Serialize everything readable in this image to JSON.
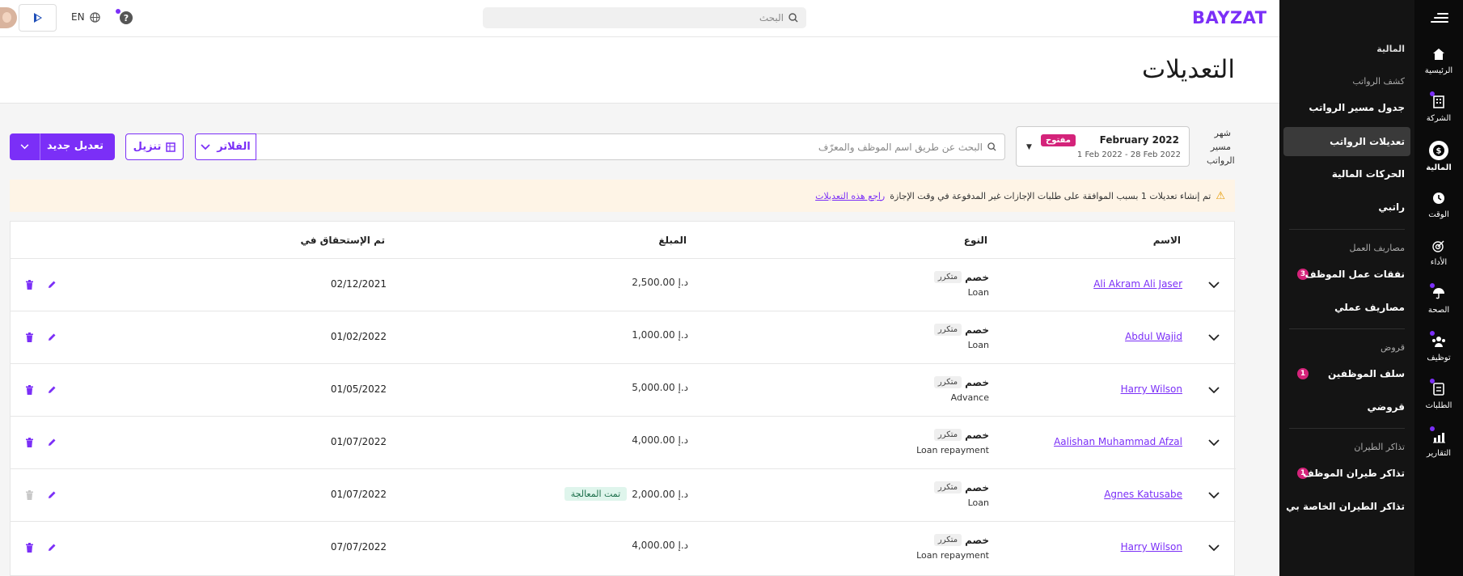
{
  "app": {
    "brand": "BAYZAT"
  },
  "topbar": {
    "lang": "EN",
    "search_placeholder": "البحث",
    "help": "?"
  },
  "page": {
    "title": "التعديلات"
  },
  "sidebar": {
    "rail": [
      {
        "label": "الرئيسية",
        "icon": "home-icon"
      },
      {
        "label": "الشركة",
        "icon": "building-icon"
      },
      {
        "label": "المالية",
        "icon": "dollar-icon"
      },
      {
        "label": "الوقت",
        "icon": "clock-icon"
      },
      {
        "label": "الأداء",
        "icon": "target-icon"
      },
      {
        "label": "الصحة",
        "icon": "umbrella-icon"
      },
      {
        "label": "توظيف",
        "icon": "people-icon"
      },
      {
        "label": "الطلبات",
        "icon": "request-icon"
      },
      {
        "label": "التقارير",
        "icon": "chart-icon"
      }
    ],
    "header": "المالية",
    "sections": {
      "payroll": "كشف الرواتب",
      "expenses": "مصاريف العمل",
      "loans": "قروض",
      "tickets": "تذاكر الطيران"
    },
    "items": {
      "payroll_table": "جدول مسير الرواتب",
      "payroll_adjustments": "تعديلات الرواتب",
      "financial_transactions": "الحركات المالية",
      "my_salary": "راتبي",
      "employee_expenses": "نفقات عمل الموظف",
      "my_expenses": "مصاريف عملي",
      "employee_advances": "سلف الموظفين",
      "my_loans": "قروضي",
      "employee_tickets": "تذاكر طيران الموظف",
      "my_tickets": "تذاكر الطيران الخاصة بي"
    },
    "badges": {
      "employee_expenses": "3",
      "employee_advances": "1",
      "employee_tickets": "1"
    }
  },
  "toolbar": {
    "period_label": "شهر مسير الرواتب",
    "period_title": "February 2022",
    "period_range": "1 Feb 2022 - 28 Feb 2022",
    "period_status": "مفتوح",
    "search_placeholder": "البحث عن طريق اسم الموظف والمعرّف",
    "filters": "الفلاتر",
    "download": "تنزيل",
    "new_adjustment": "تعديل جديد"
  },
  "alert": {
    "text": "تم إنشاء تعديلات 1 بسبب الموافقة على طلبات الإجازات غير المدفوعة في وقت الإجازة",
    "link": "راجع هذه التعديلات"
  },
  "table": {
    "columns": {
      "name": "الاسم",
      "type": "النوع",
      "amount": "المبلغ",
      "due": "تم الإستحقاق في"
    },
    "rows": [
      {
        "name": "Ali Akram Ali Jaser",
        "type": "خصم",
        "tag": "متكرر",
        "subtype": "Loan",
        "amount": "2,500.00 د.إ",
        "status": "",
        "due": "02/12/2021",
        "delete_enabled": true
      },
      {
        "name": "Abdul Wajid",
        "type": "خصم",
        "tag": "متكرر",
        "subtype": "Loan",
        "amount": "1,000.00 د.إ",
        "status": "",
        "due": "01/02/2022",
        "delete_enabled": true
      },
      {
        "name": "Harry Wilson",
        "type": "خصم",
        "tag": "متكرر",
        "subtype": "Advance",
        "amount": "5,000.00 د.إ",
        "status": "",
        "due": "01/05/2022",
        "delete_enabled": true
      },
      {
        "name": "Aalishan Muhammad Afzal",
        "type": "خصم",
        "tag": "متكرر",
        "subtype": "Loan repayment",
        "amount": "4,000.00 د.إ",
        "status": "",
        "due": "01/07/2022",
        "delete_enabled": true
      },
      {
        "name": "Agnes Katusabe",
        "type": "خصم",
        "tag": "متكرر",
        "subtype": "Loan",
        "amount": "2,000.00 د.إ",
        "status": "تمت المعالجة",
        "due": "01/07/2022",
        "delete_enabled": false
      },
      {
        "name": "Harry Wilson",
        "type": "خصم",
        "tag": "متكرر",
        "subtype": "Loan repayment",
        "amount": "4,000.00 د.إ",
        "status": "",
        "due": "07/07/2022",
        "delete_enabled": true
      }
    ]
  },
  "colors": {
    "accent": "#7b2ff7",
    "badge": "#d4237a",
    "sidebar_bg": "#141414",
    "alert_bg": "#fef4e6"
  }
}
